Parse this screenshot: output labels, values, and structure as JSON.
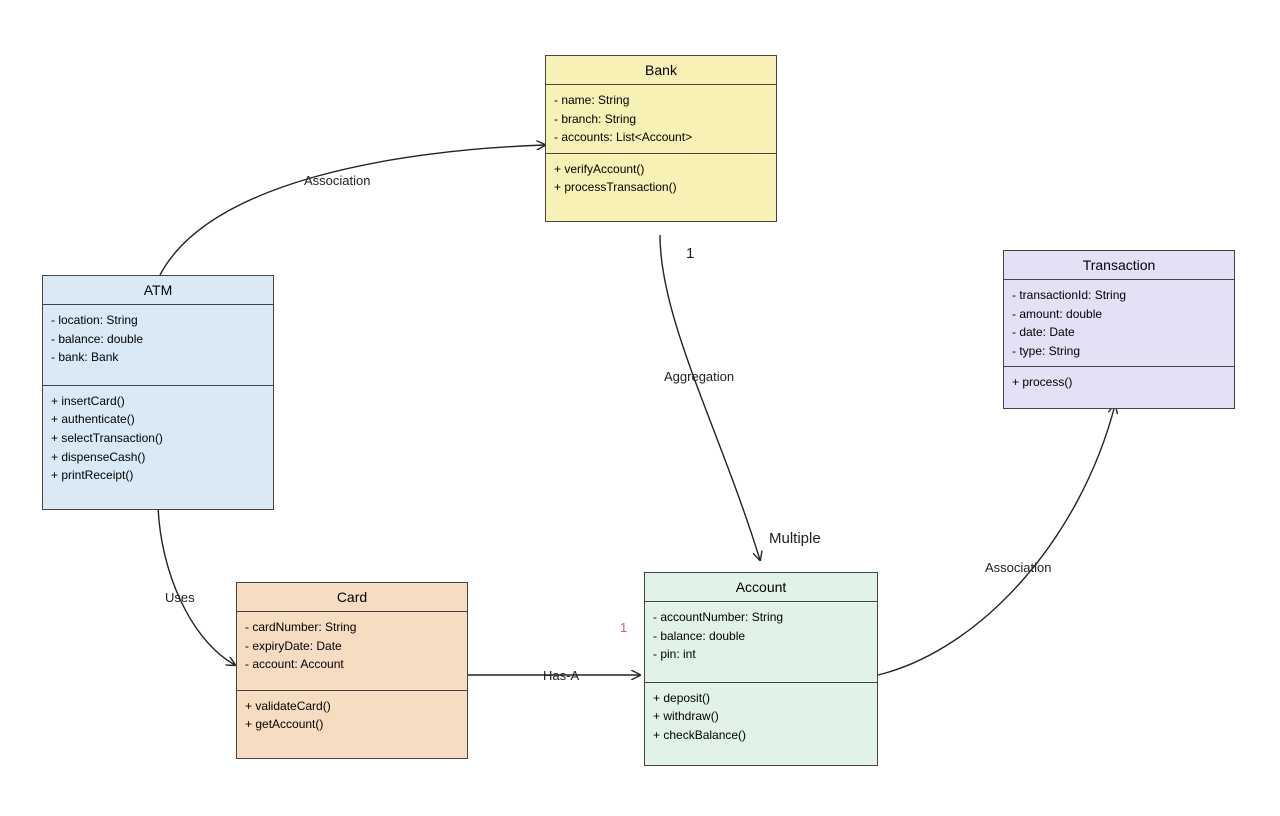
{
  "classes": {
    "bank": {
      "name": "Bank",
      "attrs": [
        "- name: String",
        "- branch: String",
        "- accounts: List<Account>"
      ],
      "methods": [
        "+ verifyAccount()",
        "+ processTransaction()"
      ]
    },
    "atm": {
      "name": "ATM",
      "attrs": [
        "- location: String",
        "- balance: double",
        "- bank: Bank"
      ],
      "methods": [
        "+ insertCard()",
        "+ authenticate()",
        "+ selectTransaction()",
        "+ dispenseCash()",
        "+ printReceipt()"
      ]
    },
    "transaction": {
      "name": "Transaction",
      "attrs": [
        "- transactionId: String",
        "- amount: double",
        "- date: Date",
        "- type: String"
      ],
      "methods": [
        "+ process()"
      ]
    },
    "card": {
      "name": "Card",
      "attrs": [
        "- cardNumber: String",
        "- expiryDate: Date",
        "- account: Account"
      ],
      "methods": [
        "+ validateCard()",
        "+ getAccount()"
      ]
    },
    "account": {
      "name": "Account",
      "attrs": [
        "- accountNumber: String",
        "- balance: double",
        "- pin: int"
      ],
      "methods": [
        "+ deposit()",
        "+ withdraw()",
        "+ checkBalance()"
      ]
    }
  },
  "labels": {
    "association_atm_bank": "Association",
    "aggregation": "Aggregation",
    "uses": "Uses",
    "has_a": "Has-A",
    "multiple": "Multiple",
    "association_acct_txn": "Association",
    "one_bank": "1",
    "one_card": "1"
  },
  "colors": {
    "bank": "#f8f1b6",
    "atm": "#d9eaf6",
    "transaction": "#e4e0f6",
    "card": "#f6ddc2",
    "account": "#e0f3e6"
  }
}
